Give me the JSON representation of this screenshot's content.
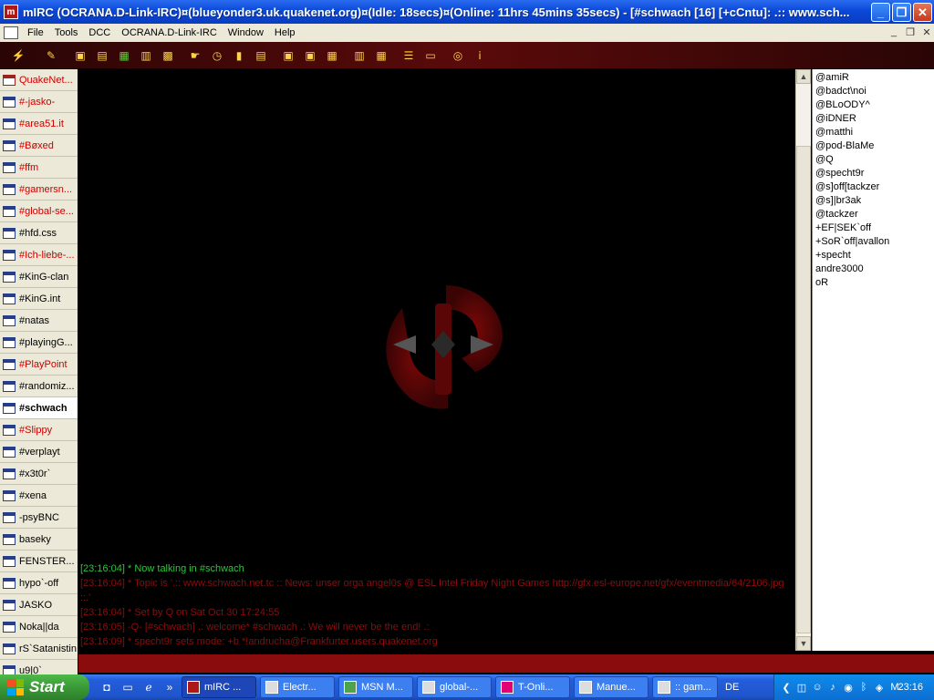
{
  "window": {
    "title": "mIRC (OCRANA.D-Link-IRC)¤(blueyonder3.uk.quakenet.org)¤(Idle: 18secs)¤(Online: 11hrs 45mins 35secs) - [#schwach [16] [+cCntu]: .:: www.sch..."
  },
  "menu": [
    "File",
    "Tools",
    "DCC",
    "OCRANA.D-Link-IRC",
    "Window",
    "Help"
  ],
  "switchbar": [
    {
      "label": "QuakeNet...",
      "type": "status",
      "highlight": true
    },
    {
      "label": "#-jasko-",
      "type": "channel",
      "highlight": true
    },
    {
      "label": "#area51.it",
      "type": "channel",
      "highlight": true
    },
    {
      "label": "#Bøxed",
      "type": "channel",
      "highlight": true
    },
    {
      "label": "#ffm",
      "type": "channel",
      "highlight": true
    },
    {
      "label": "#gamersn...",
      "type": "channel",
      "highlight": true
    },
    {
      "label": "#global-se...",
      "type": "channel",
      "highlight": true
    },
    {
      "label": "#hfd.css",
      "type": "channel",
      "highlight": false
    },
    {
      "label": "#Ich-liebe-...",
      "type": "channel",
      "highlight": true
    },
    {
      "label": "#KinG-clan",
      "type": "channel",
      "highlight": false
    },
    {
      "label": "#KinG.int",
      "type": "channel",
      "highlight": false
    },
    {
      "label": "#natas",
      "type": "channel",
      "highlight": false
    },
    {
      "label": "#playingG...",
      "type": "channel",
      "highlight": false
    },
    {
      "label": "#PlayPoint",
      "type": "channel",
      "highlight": true
    },
    {
      "label": "#randomiz...",
      "type": "channel",
      "highlight": false
    },
    {
      "label": "#schwach",
      "type": "channel",
      "highlight": false,
      "active": true
    },
    {
      "label": "#Slippy",
      "type": "channel",
      "highlight": true
    },
    {
      "label": "#verplayt",
      "type": "channel",
      "highlight": false
    },
    {
      "label": "#x3t0r`",
      "type": "channel",
      "highlight": false
    },
    {
      "label": "#xena",
      "type": "channel",
      "highlight": false
    },
    {
      "label": "-psyBNC",
      "type": "query",
      "highlight": false
    },
    {
      "label": "baseky",
      "type": "query",
      "highlight": false
    },
    {
      "label": "FENSTER...",
      "type": "query",
      "highlight": false
    },
    {
      "label": "hypo`-off",
      "type": "query",
      "highlight": false
    },
    {
      "label": "JASKO",
      "type": "query",
      "highlight": false
    },
    {
      "label": "Noka||da",
      "type": "query",
      "highlight": false
    },
    {
      "label": "rS`Satanistin",
      "type": "query",
      "highlight": false
    },
    {
      "label": "u9|0`",
      "type": "query",
      "highlight": false
    }
  ],
  "chat_lines": [
    {
      "text": "[23:16:04] * Now talking in #schwach",
      "color": "green"
    },
    {
      "text": "[23:16:04] * Topic is '.:: www.schwach.net.tc :: News: unser orga angel0s @ ESL Intel Friday Night Games http://gfx.esl-europe.net/gfx/eventmedia/64/2106.jpg ::.'",
      "color": "red"
    },
    {
      "text": "[23:16:04] * Set by Q on Sat Oct 30 17:24:55",
      "color": "red"
    },
    {
      "text": "[23:16:05] -Q- [#schwach] .: welcome* #schwach .: We will never be the end! .:",
      "color": "red"
    },
    {
      "text": "[23:16:09] * specht9r sets mode: +b *!andrucha@Frankfurter.users.quakenet.org",
      "color": "red"
    }
  ],
  "nicklist": [
    "@amiR",
    "@badct\\noi",
    "@BLoODY^",
    "@iDNER",
    "@matthi",
    "@pod-BlaMe",
    "@Q",
    "@specht9r",
    "@s]off[tackzer",
    "@s]|br3ak",
    "@tackzer",
    "+EF|SEK`off",
    "+SoR`off|avallon",
    "+specht",
    "andre3000",
    "oR"
  ],
  "editbox": {
    "value": ""
  },
  "taskbar": {
    "start_label": "Start",
    "tasks": [
      {
        "label": "mIRC ...",
        "active": true
      },
      {
        "label": "Electr...",
        "active": false
      },
      {
        "label": "MSN M...",
        "active": false
      },
      {
        "label": "global-...",
        "active": false
      },
      {
        "label": "T-Onli...",
        "active": false
      },
      {
        "label": "Manue...",
        "active": false
      },
      {
        "label": ":: gam...",
        "active": false
      }
    ],
    "language": "DE",
    "clock": "23:16"
  },
  "colors": {
    "accent_red": "#8a0c0c",
    "chat_green": "#2ec43a",
    "chat_red": "#8a0e0e",
    "highlight_text": "#cc0000"
  }
}
